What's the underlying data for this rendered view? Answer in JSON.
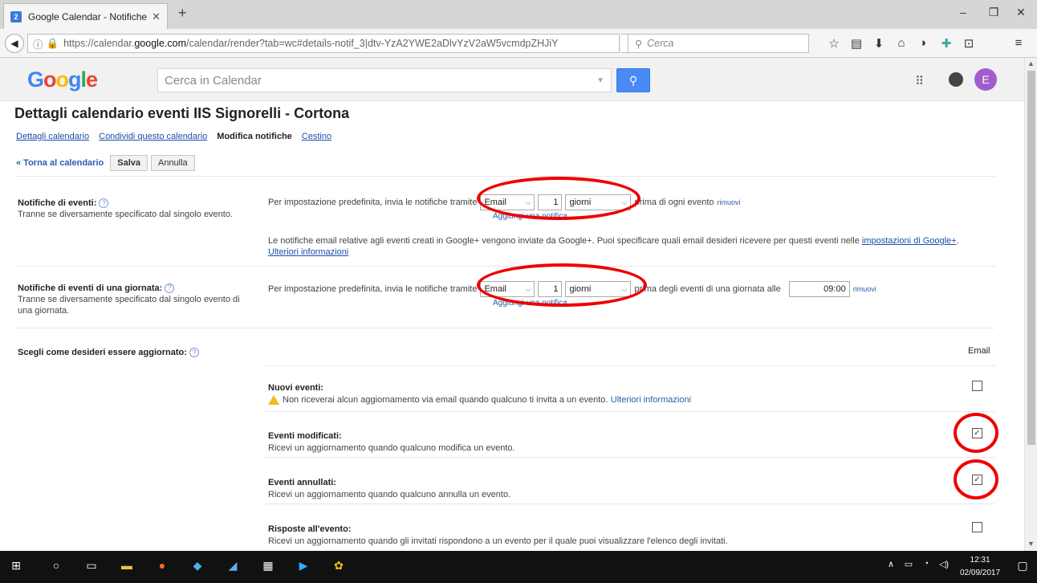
{
  "browser": {
    "tab_title": "Google Calendar - Notifiche",
    "tab_badge": "2",
    "url_prefix": "https://calendar.",
    "url_domain": "google.com",
    "url_rest": "/calendar/render?tab=wc#details-notif_3|dtv-YzA2YWE2aDlvYzV2aW5vcmdpZHJiY",
    "search_placeholder": "Cerca"
  },
  "google": {
    "logo": "Google",
    "search_placeholder": "Cerca in Calendar",
    "avatar_letter": "E",
    "logo_colors": [
      "#4285f4",
      "#ea4335",
      "#fbbc05",
      "#4285f4",
      "#34a853",
      "#ea4335"
    ]
  },
  "page": {
    "title": "Dettagli calendario eventi IIS Signorelli - Cortona",
    "subtabs": [
      "Dettagli calendario",
      "Condividi questo calendario",
      "Modifica notifiche",
      "Cestino"
    ],
    "back_link": "« Torna al calendario",
    "save": "Salva",
    "cancel": "Annulla"
  },
  "event_notif": {
    "title": "Notifiche di eventi:",
    "subtitle": "Tranne se diversamente specificato dal singolo evento.",
    "pre": "Per impostazione predefinita, invia le notifiche tramite",
    "method": "Email",
    "number": "1",
    "unit": "giorni",
    "post": "prima di ogni evento",
    "remove": "rimuovi",
    "add": "Aggiungi una notifica",
    "info_text": "Le notifiche email relative agli eventi creati in Google+ vengono inviate da Google+. Puoi specificare quali email desideri ricevere per questi eventi nelle",
    "info_link": "impostazioni di Google+",
    "info_end": ".",
    "more_info": "Ulteriori informazioni"
  },
  "allday_notif": {
    "title": "Notifiche di eventi di una giornata:",
    "subtitle": "Tranne se diversamente specificato dal singolo evento di una giornata.",
    "pre": "Per impostazione predefinita, invia le notifiche tramite",
    "method": "Email",
    "number": "1",
    "unit": "giorni",
    "post": "prima degli eventi di una giornata alle",
    "time": "09:00",
    "remove": "rimuovi",
    "add": "Aggiungi una notifica"
  },
  "updates": {
    "title": "Scegli come desideri essere aggiornato:",
    "column": "Email",
    "rows": [
      {
        "title": "Nuovi eventi:",
        "desc": "Non riceverai alcun aggiornamento via email quando qualcuno ti invita a un evento.",
        "link": "Ulteriori informazioni",
        "checked": false
      },
      {
        "title": "Eventi modificati:",
        "desc": "Ricevi un aggiornamento quando qualcuno modifica un evento.",
        "checked": true
      },
      {
        "title": "Eventi annullati:",
        "desc": "Ricevi un aggiornamento quando qualcuno annulla un evento.",
        "checked": true
      },
      {
        "title": "Risposte all'evento:",
        "desc": "Ricevi un aggiornamento quando gli invitati rispondono a un evento per il quale puoi visualizzare l'elenco degli invitati.",
        "checked": false
      }
    ]
  },
  "taskbar": {
    "time": "12:31",
    "date": "02/09/2017"
  }
}
